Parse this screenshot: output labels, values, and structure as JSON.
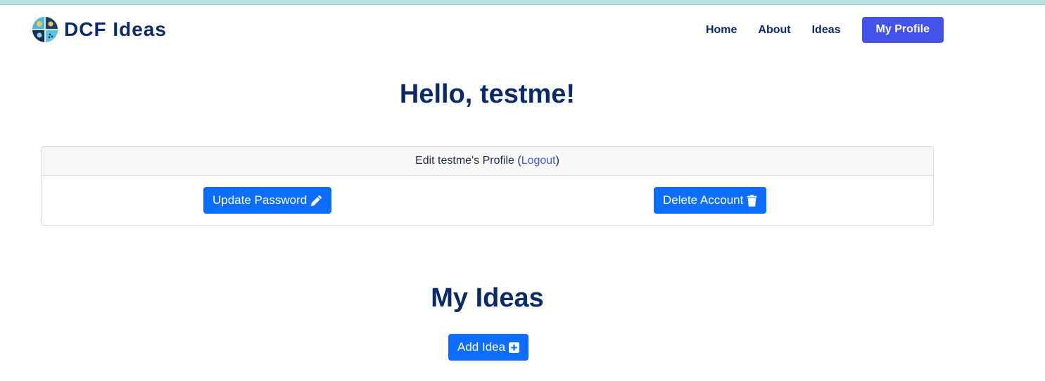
{
  "brand": {
    "name": "DCF Ideas",
    "logo_icon": "quad-circle-logo"
  },
  "nav": {
    "home": "Home",
    "about": "About",
    "ideas": "Ideas",
    "profile": "My Profile",
    "profile_bg": "#4353e9"
  },
  "greeting": "Hello, testme!",
  "profile_card": {
    "header_prefix": "Edit testme's Profile (",
    "logout": "Logout",
    "header_suffix": ")",
    "update_password": "Update Password",
    "update_icon": "pencil-icon",
    "delete_account": "Delete Account",
    "delete_icon": "trash-icon"
  },
  "ideas_section": {
    "title": "My Ideas",
    "add_idea": "Add Idea",
    "add_icon": "plus-square-icon"
  },
  "colors": {
    "primary_button": "#0d6efd",
    "heading": "#0b2a66",
    "link": "#3f5ce0"
  }
}
